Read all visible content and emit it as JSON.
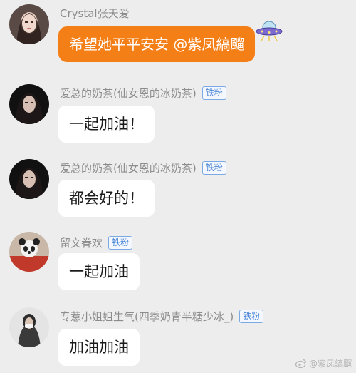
{
  "messages": [
    {
      "sender": "Crystal张天爱",
      "badge": "",
      "text": "希望她平平安安 @紫凤縞飀"
    },
    {
      "sender": "爱总的奶茶(仙女恩的冰奶茶)",
      "badge": "铁粉",
      "text": "一起加油！"
    },
    {
      "sender": "爱总的奶茶(仙女恩的冰奶茶)",
      "badge": "铁粉",
      "text": "都会好的！"
    },
    {
      "sender": "留文眷欢",
      "badge": "铁粉",
      "text": "一起加油"
    },
    {
      "sender": "专惹小姐姐生气(四季奶青半糖少冰_)",
      "badge": "铁粉",
      "text": "加油加油"
    }
  ],
  "watermark": "@紫凤縞飀",
  "colors": {
    "background": "#ededed",
    "highlight_bubble": "#f57f17",
    "badge": "#4a86d6"
  },
  "icons": [
    "ufo-sticker-icon",
    "weibo-logo-icon"
  ]
}
